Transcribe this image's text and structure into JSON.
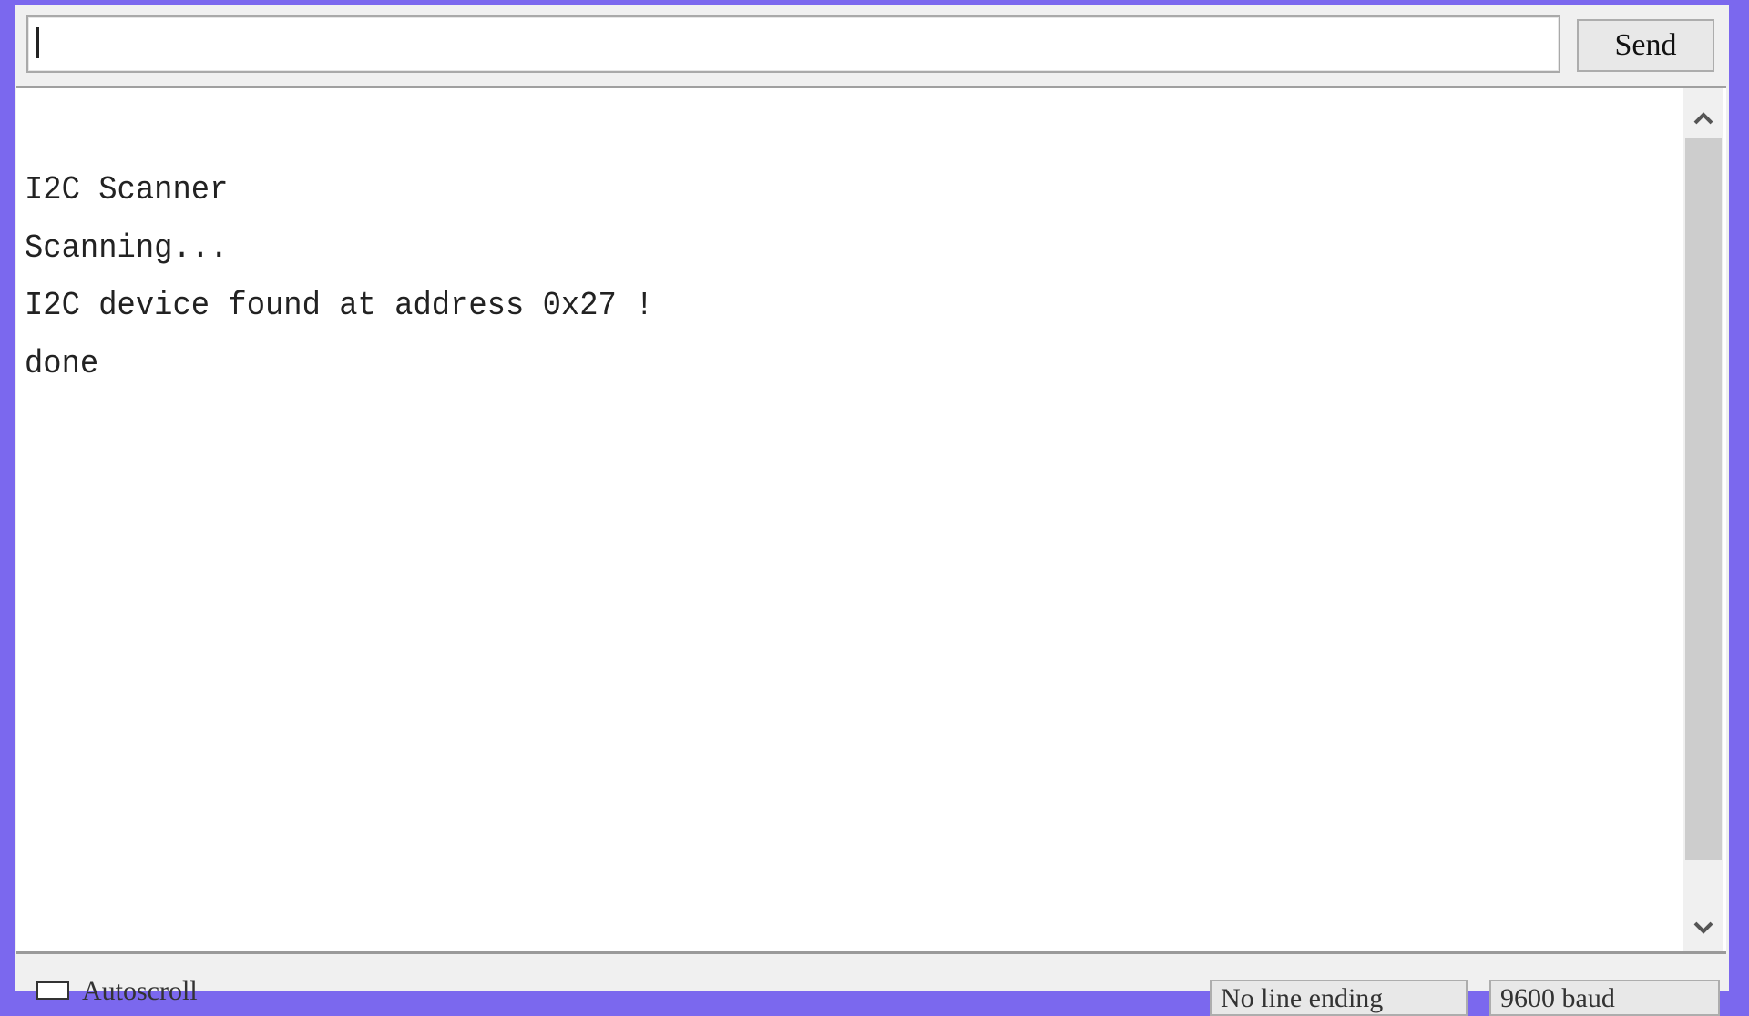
{
  "serial_monitor": {
    "input": {
      "value": "",
      "placeholder": ""
    },
    "send_label": "Send",
    "output_lines": [
      "I2C Scanner",
      "Scanning...",
      "I2C device found at address 0x27 !",
      "done"
    ],
    "scroll": {
      "thumb_fraction_start": 0.0,
      "thumb_fraction_visible": 0.88
    },
    "bottom_bar": {
      "autoscroll_label": "Autoscroll",
      "autoscroll_checked": false,
      "line_ending_selected": "No line ending",
      "baud_selected": "9600 baud"
    }
  },
  "icons": {
    "scroll_up": "chevron-up-icon",
    "scroll_down": "chevron-down-icon"
  },
  "colors": {
    "desktop_accent": "#7b68ee",
    "window_bg": "#f0f0f0",
    "output_bg": "#ffffff",
    "scroll_thumb": "#cdcdcd"
  }
}
